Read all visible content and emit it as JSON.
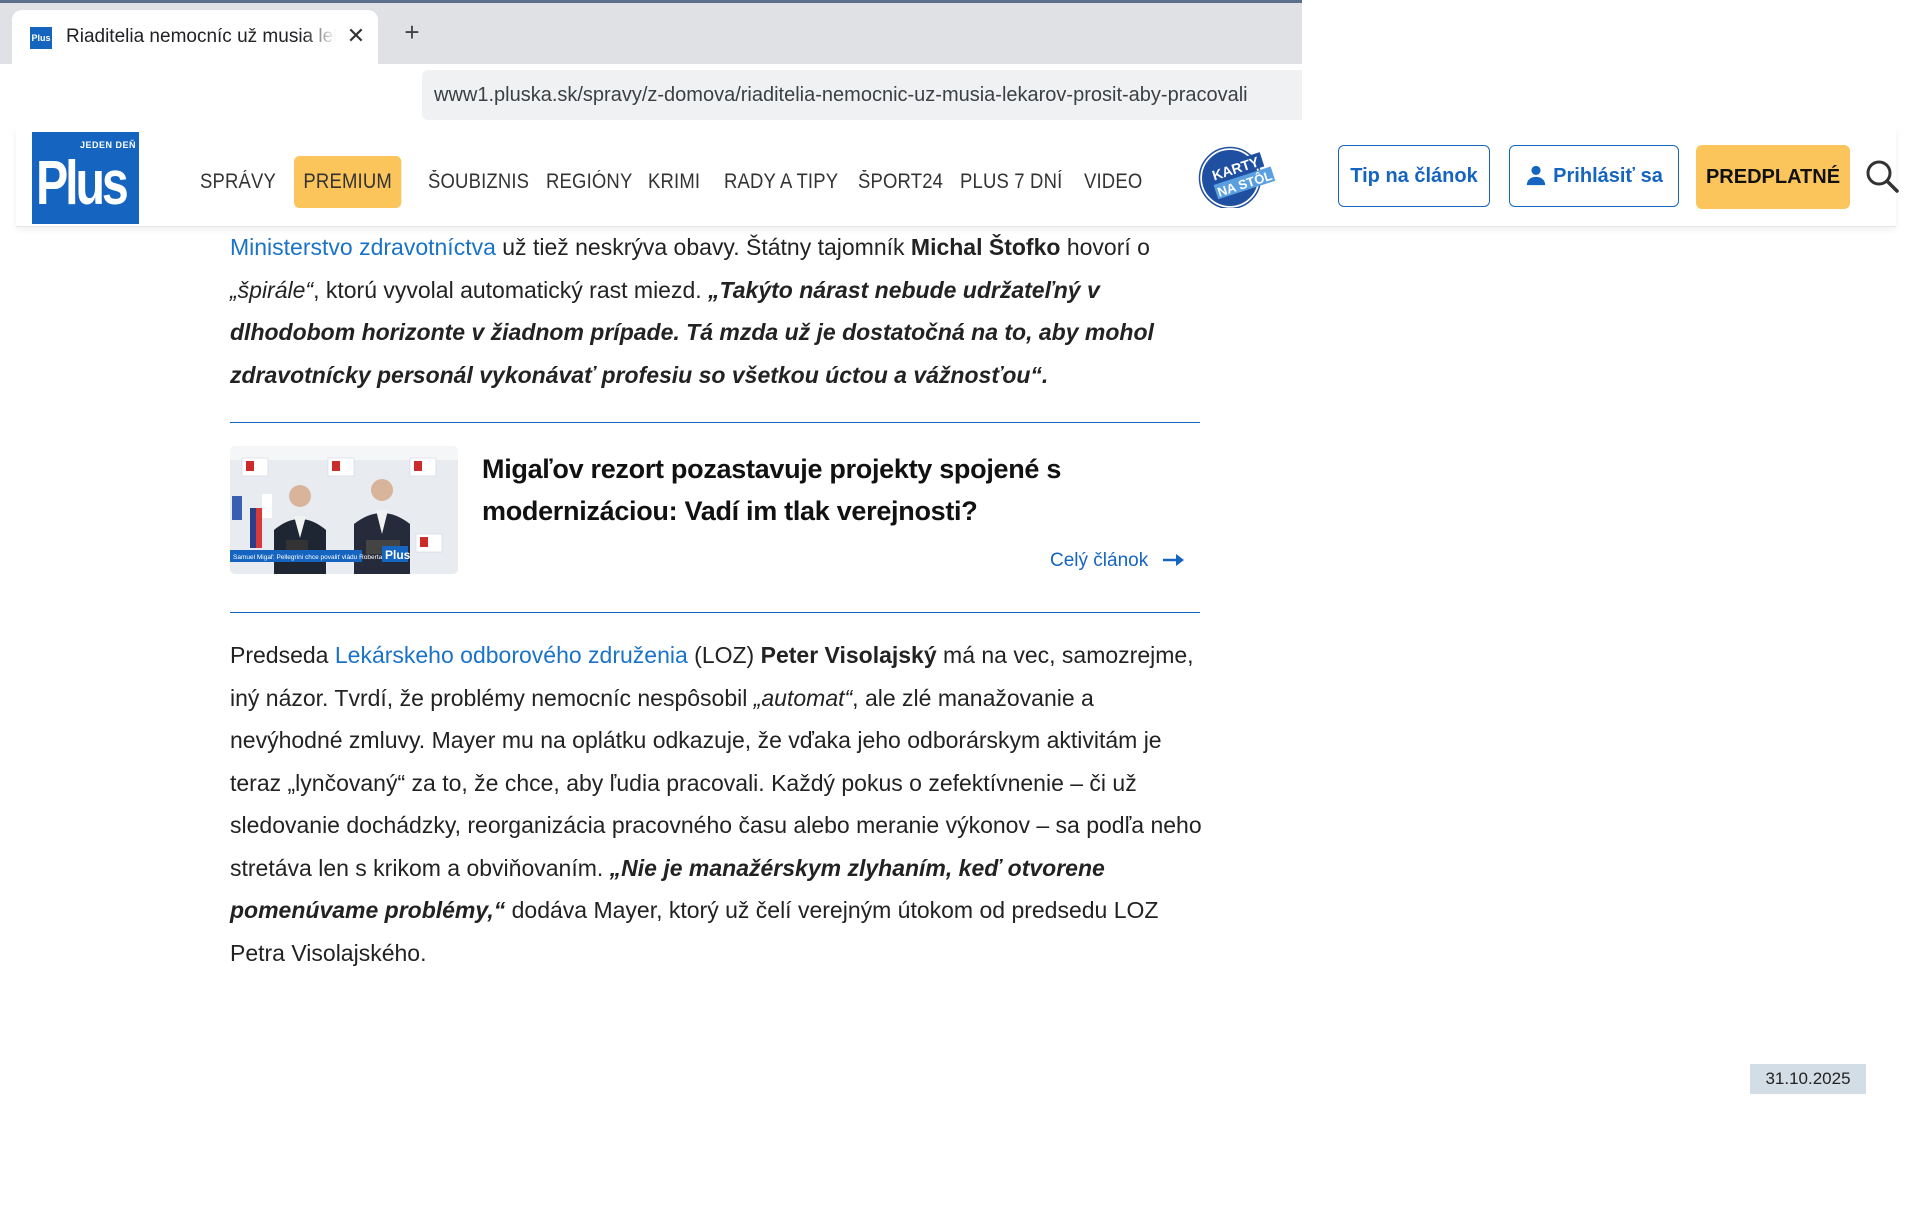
{
  "browser": {
    "tab_title": "Riaditelia nemocníc už musia lekárov prosiť, aby pracovali",
    "tab_close": "✕",
    "new_tab": "+",
    "url": "www1.pluska.sk/spravy/z-domova/riaditelia-nemocnic-uz-musia-lekarov-prosit-aby-pracovali",
    "favicon_text": "Plus"
  },
  "header": {
    "logo_top": "JEDEN DEŇ",
    "logo_main": "Plus",
    "nav": [
      "SPRÁVY",
      "PREMIUM",
      "ŠOUBIZNIS",
      "REGIÓNY",
      "KRIMI",
      "RADY A TIPY",
      "ŠPORT24",
      "PLUS 7 DNÍ",
      "VIDEO"
    ],
    "karty_line1": "KARTY",
    "karty_line2": "NA STÔL",
    "tip_button": "Tip na článok",
    "login_button": "Prihlásiť sa",
    "subscribe_button": "PREDPLATNÉ",
    "colors": {
      "brand_blue": "#1565c0",
      "premium_yellow": "#fbc55c"
    }
  },
  "article": {
    "p1": {
      "link": "Ministerstvo zdravotníctva",
      "t1": " už tiež neskrýva obavy. Štátny tajomník ",
      "name": "Michal Štofko",
      "t2": " hovorí o ",
      "italic": "„špirále“",
      "t3": ", ktorú vyvolal automatický rast miezd. ",
      "quote": "„Takýto nárast nebude udržateľný v dlhodobom horizonte v žiadnom prípade. Tá mzda už je dostatočná na to, aby mohol zdravotnícky personál vykonávať profesiu so všetkou úctou a vážnosťou“."
    },
    "related": {
      "title": "Migaľov rezort pozastavuje projekty spojené s modernizáciou: Vadí im tlak verejnosti?",
      "link": "Celý článok",
      "thumb_caption": "Samuel Migaľ: Pellegrini chce povaliť vládu Roberta Fica"
    },
    "p2": {
      "t1": "Predseda ",
      "link": "Lekárskeho odborového združenia",
      "t2": " (LOZ) ",
      "name": "Peter Visolajský",
      "t3": " má na vec, samozrejme, iný názor. Tvrdí, že problémy nemocníc nespôsobil ",
      "italic": "„automat“",
      "t4": ", ale zlé manažovanie a nevýhodné zmluvy. Mayer mu na oplátku odkazuje, že vďaka jeho odborárskym aktivitám je teraz „lynčovaný“ za to, že chce, aby ľudia pracovali. Každý pokus o zefektívnenie – či už sledovanie dochádzky, reorganizácia pracovného času alebo meranie výkonov – sa podľa neho stretáva len s krikom a obviňovaním. ",
      "quote": "„Nie je manažérskym zlyhaním, keď otvorene pomenúvame problémy,“",
      "t5": " dodáva Mayer, ktorý už čelí verejným útokom od predsedu LOZ Petra Visolajského."
    }
  },
  "date_badge": "31.10.2025"
}
